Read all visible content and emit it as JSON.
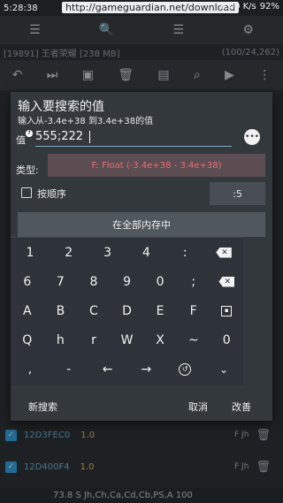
{
  "status_bar": {
    "time": "5:28:38",
    "url": "http://gameguardian.net/download",
    "network": "0.00 K/s",
    "battery": "92%"
  },
  "background": {
    "process": "[19891] 王者荣耀 [238 MB]",
    "result_count": "(100/24,262)",
    "rows": [
      {
        "address": "12D3FEC0",
        "value": "1.0",
        "flag": "F\nJh"
      },
      {
        "address": "12D400F4",
        "value": "1.0",
        "flag": "F\nJh"
      }
    ],
    "bottom_text": "73.8 S Jh,Ch,Ca,Cd,Cb,PS,A 100"
  },
  "dialog": {
    "title": "输入要搜索的值",
    "subtitle": "输入从-3.4e+38 到3.4e+38的值",
    "value_label": "值",
    "value_input": "555;222",
    "type_label": "类型:",
    "type_value": "F: Float (-3.4e+38 - 3.4e+38)",
    "order_label": "按顺序",
    "order_value": ":5",
    "search_all_label": "在全部内存中",
    "new_search_label": "新搜索",
    "cancel_label": "取消",
    "modify_label": "改善"
  },
  "keyboard": {
    "row1": [
      "1",
      "2",
      "3",
      "4",
      ":",
      "bs"
    ],
    "row2": [
      "6",
      "7",
      "8",
      "9",
      "0",
      ";",
      "bs2"
    ],
    "row3": [
      "A",
      "B",
      "C",
      "D",
      "E",
      "F",
      "box"
    ],
    "row4": [
      "Q",
      "h",
      "r",
      "W",
      "X",
      "~",
      "0"
    ],
    "row5": [
      ",",
      "-",
      "←",
      "→",
      "hist",
      "x"
    ]
  }
}
